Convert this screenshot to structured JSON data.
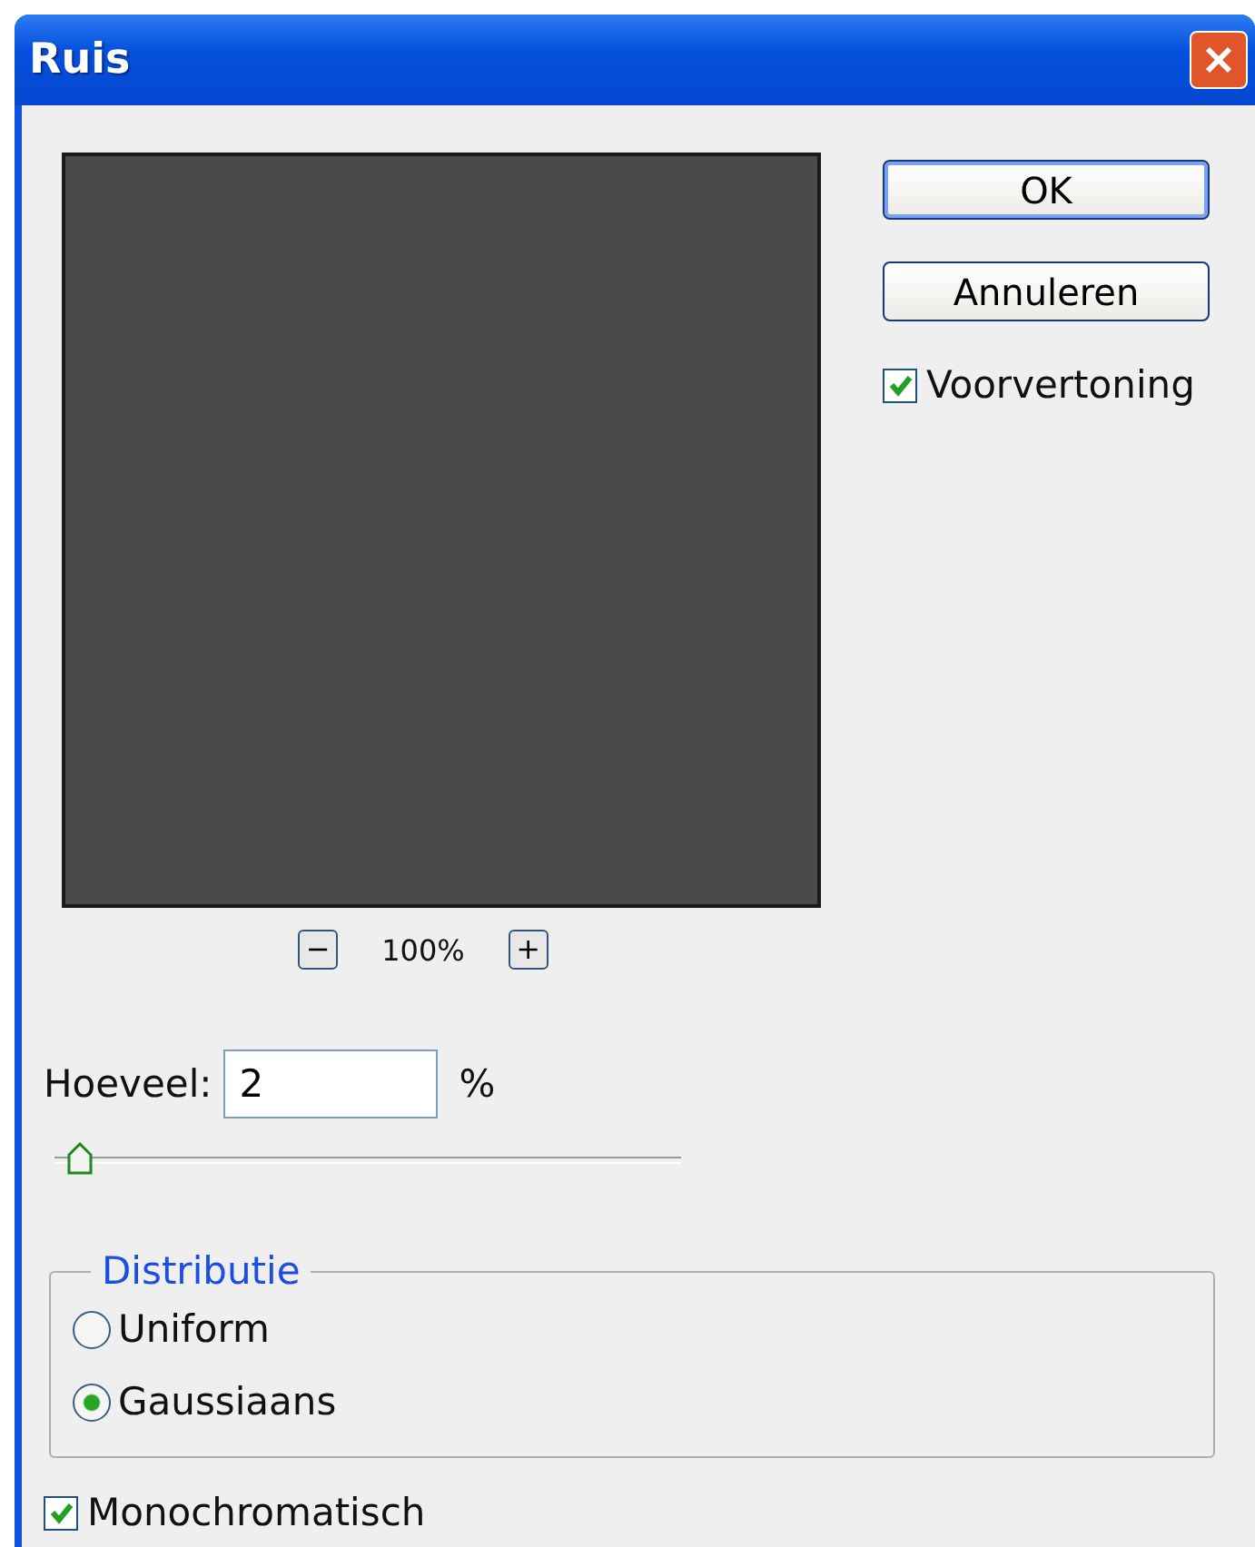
{
  "window": {
    "title": "Ruis"
  },
  "preview": {
    "zoom_out": "−",
    "zoom_level": "100%",
    "zoom_in": "+"
  },
  "buttons": [
    {
      "label": "OK",
      "default": true
    },
    {
      "label": "Annuleren",
      "default": false
    }
  ],
  "preview_checkbox": {
    "label": "Voorvertoning",
    "checked": true
  },
  "amount": {
    "label": "Hoeveel:",
    "value": "2",
    "unit": "%",
    "level": 0.02
  },
  "distribution": {
    "title": "Distributie",
    "options": [
      {
        "label": "Uniform",
        "selected": false
      },
      {
        "label": "Gaussiaans",
        "selected": true
      }
    ]
  },
  "monochromatic": {
    "label": "Monochromatisch",
    "checked": true
  }
}
